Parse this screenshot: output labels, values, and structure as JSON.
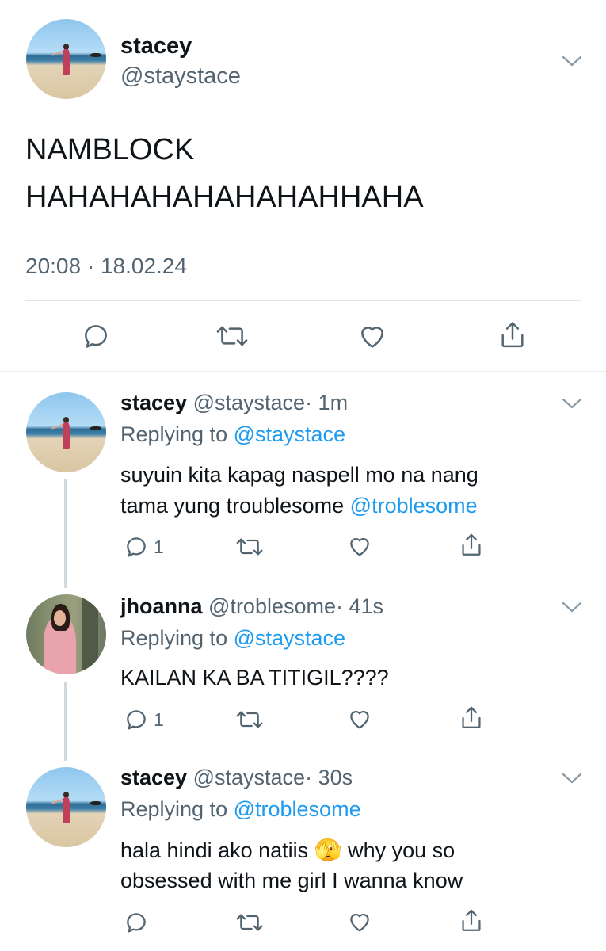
{
  "main_tweet": {
    "name": "stacey",
    "handle": "@staystace",
    "text_line1": "NAMBLOCK",
    "text_line2": "HAHAHAHAHAHAHAHHAHA",
    "timestamp": "20:08 · 18.02.24"
  },
  "replies": [
    {
      "name": "stacey",
      "handle": "@staystace",
      "time": "· 1m",
      "replying_label": "Replying to",
      "replying_to": "@staystace",
      "text_line1": "suyuin kita kapag naspell mo na nang",
      "text_line2": "tama yung troublesome",
      "mention": "@troblesome",
      "reply_count": "1"
    },
    {
      "name": "jhoanna",
      "handle": "@troblesome",
      "time": "· 41s",
      "replying_label": "Replying to",
      "replying_to": "@staystace",
      "text_line1": "KAILAN KA BA TITIGIL????",
      "reply_count": "1"
    },
    {
      "name": "stacey",
      "handle": "@staystace",
      "time": "· 30s",
      "replying_label": "Replying to",
      "replying_to": "@troblesome",
      "text_line1a": "hala hindi ako natiis",
      "emoji": "🫣",
      "text_line1b": "why you so",
      "text_line2": "obsessed with me girl I wanna know",
      "reply_count": ""
    }
  ],
  "icons": {
    "reply": "comment-icon",
    "retweet": "retweet-icon",
    "like": "heart-icon",
    "share": "share-icon",
    "more": "chevron-down-icon"
  },
  "colors": {
    "link": "#1d9bf0",
    "secondary_text": "#536471",
    "icon": "#536471"
  }
}
